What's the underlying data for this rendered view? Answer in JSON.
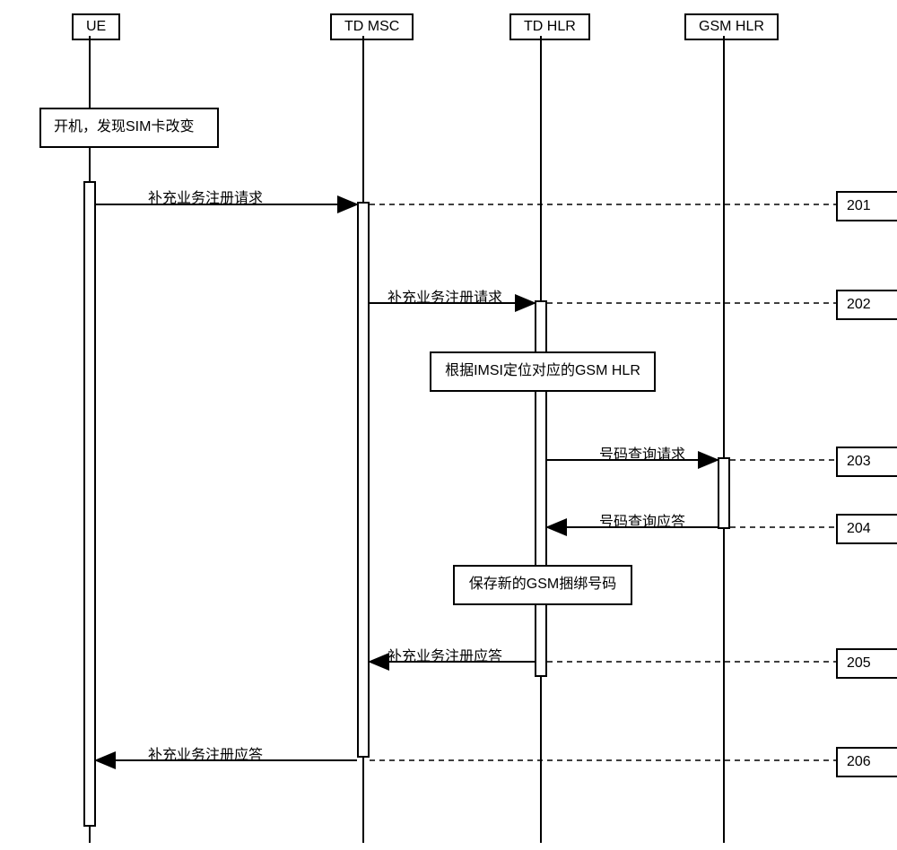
{
  "participants": {
    "ue": "UE",
    "td_msc": "TD MSC",
    "td_hlr": "TD HLR",
    "gsm_hlr": "GSM HLR"
  },
  "boxes": {
    "sim_change": "开机，发现SIM卡改变",
    "locate_gsm_hlr": "根据IMSI定位对应的GSM HLR",
    "save_number": "保存新的GSM捆绑号码"
  },
  "messages": {
    "m1": "补充业务注册请求",
    "m2": "补充业务注册请求",
    "m3": "号码查询请求",
    "m4": "号码查询应答",
    "m5": "补充业务注册应答",
    "m6": "补充业务注册应答"
  },
  "steps": {
    "s1": "201",
    "s2": "202",
    "s3": "203",
    "s4": "204",
    "s5": "205",
    "s6": "206"
  }
}
